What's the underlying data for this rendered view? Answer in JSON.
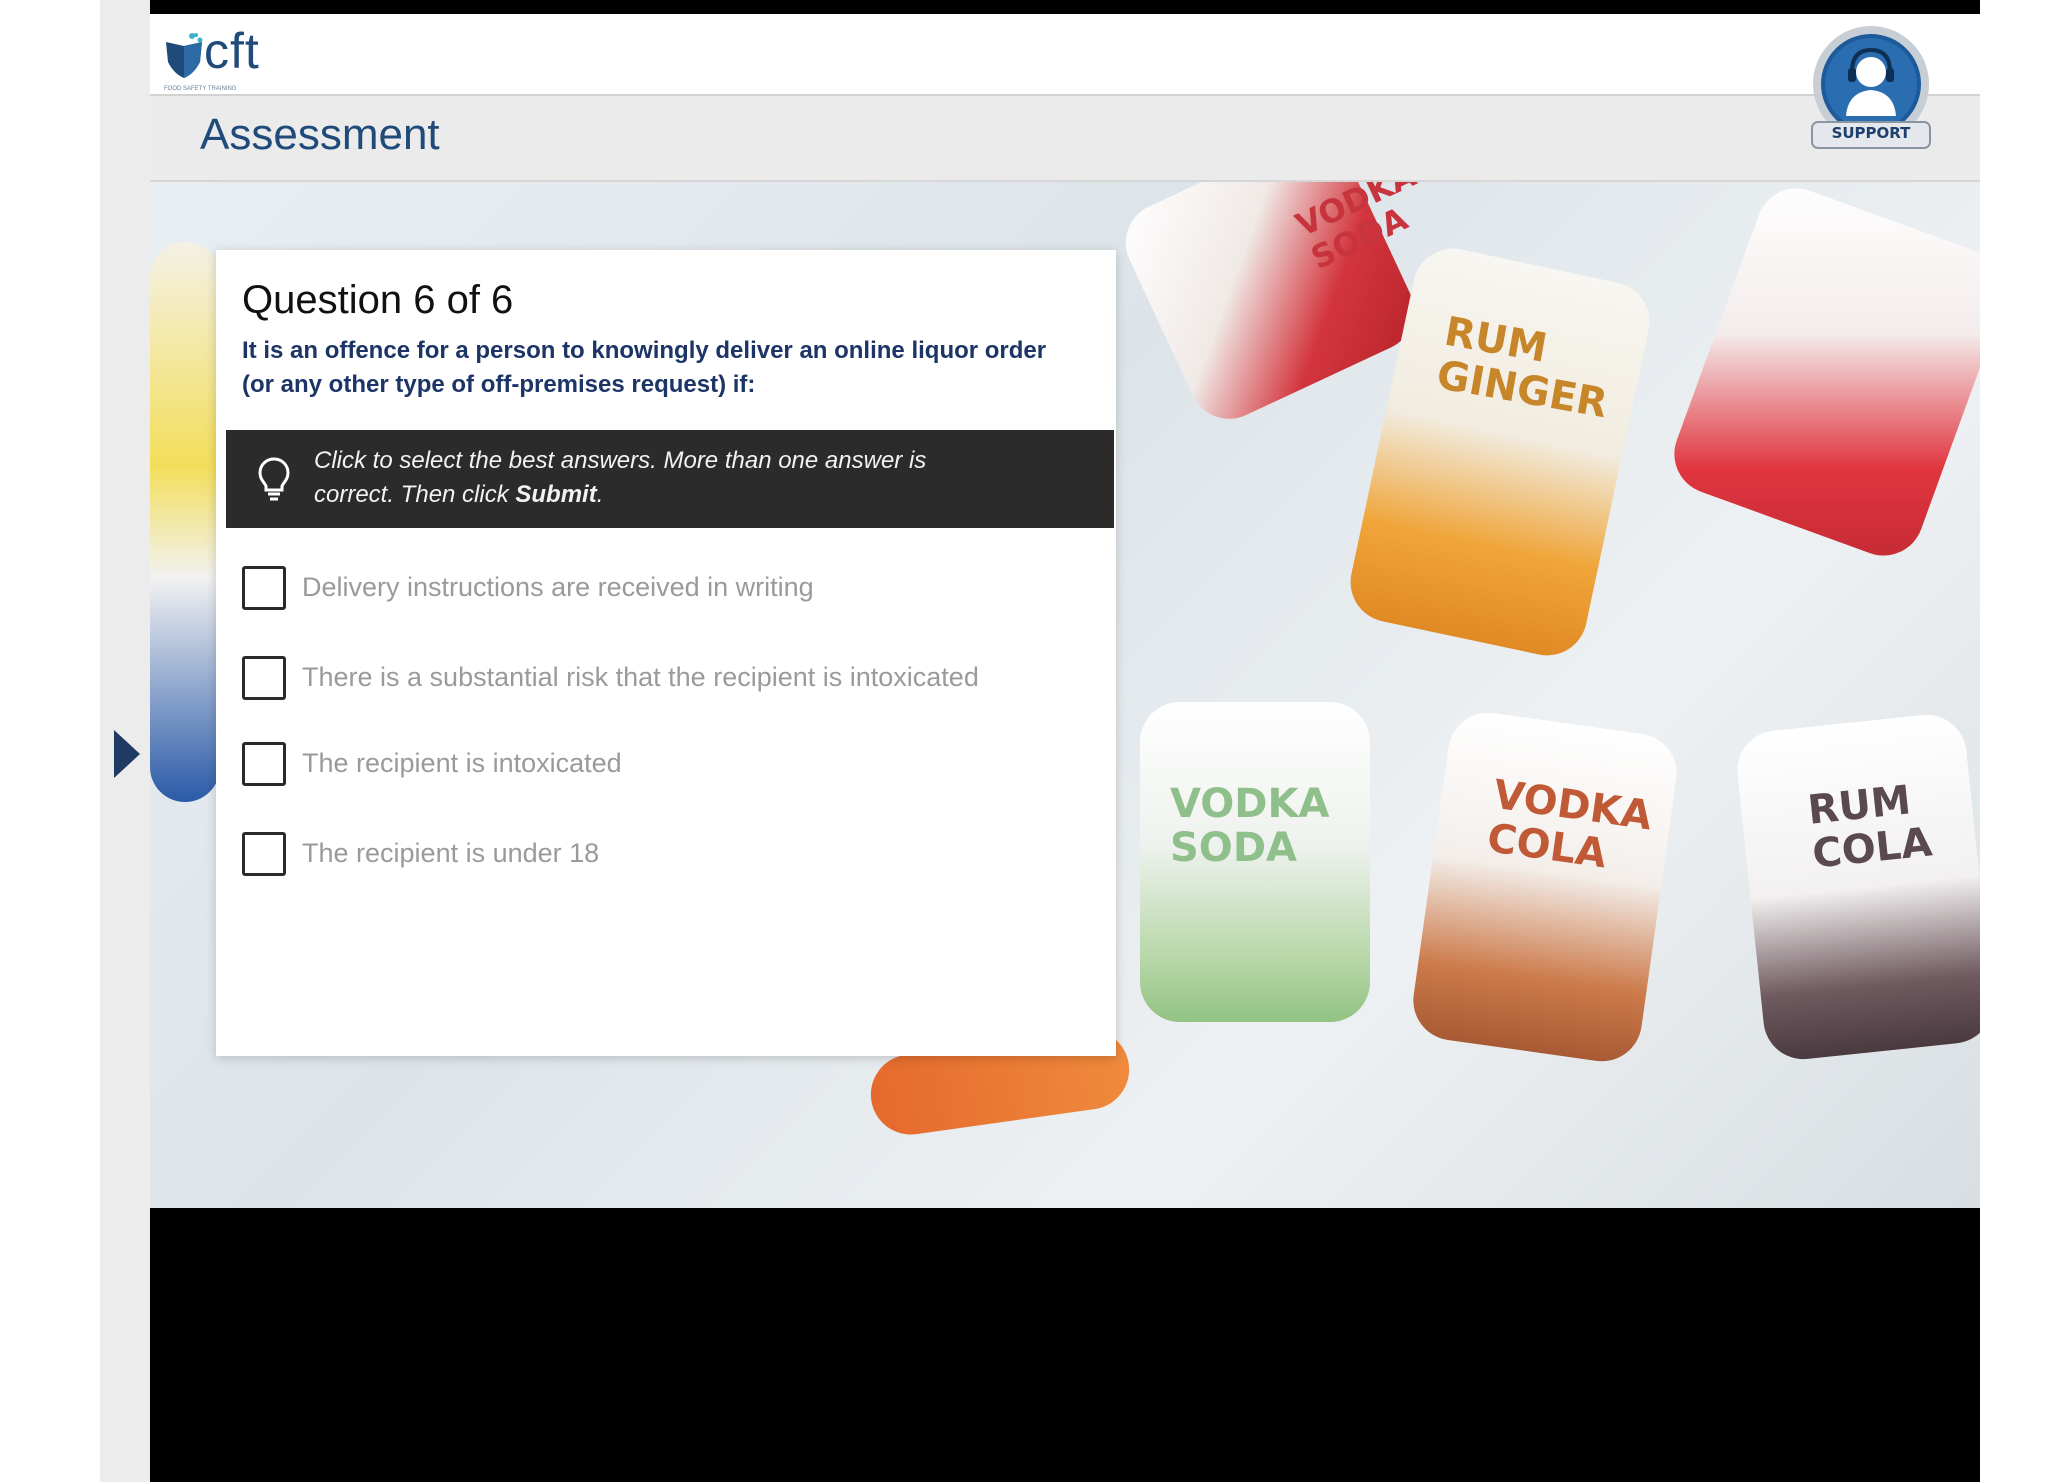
{
  "header": {
    "logo_text": "cft",
    "logo_tagline": "FOOD SAFETY TRAINING",
    "support_label": "SUPPORT"
  },
  "title_bar": {
    "title": "Assessment"
  },
  "question": {
    "heading": "Question 6 of 6",
    "text": "It is an offence for a person to knowingly deliver an online liquor order (or any other type of off-premises request) if:"
  },
  "hint": {
    "text_line1": "Click to select the best answers. More than one answer is",
    "text_line2_prefix": "correct. Then click ",
    "text_line2_bold": "Submit",
    "text_line2_suffix": "."
  },
  "options": [
    {
      "label": "Delivery instructions are received in writing",
      "checked": false
    },
    {
      "label": "There is a substantial risk that the recipient is intoxicated",
      "checked": false
    },
    {
      "label": "The recipient is intoxicated",
      "checked": false
    },
    {
      "label": "The recipient is under 18",
      "checked": false
    }
  ],
  "background_cans": {
    "labels": [
      "VODKA SODA",
      "RUM GINGER",
      "VODKA SODA",
      "VODKA COLA",
      "RUM COLA"
    ]
  },
  "colors": {
    "brand_blue": "#1f4a7a",
    "question_text": "#1c3566",
    "hint_background": "#2b2b2b",
    "option_text": "#9a9a9a"
  },
  "icons": {
    "hint": "lightbulb-icon",
    "nav": "play-triangle-icon",
    "support": "headset-user-icon"
  }
}
